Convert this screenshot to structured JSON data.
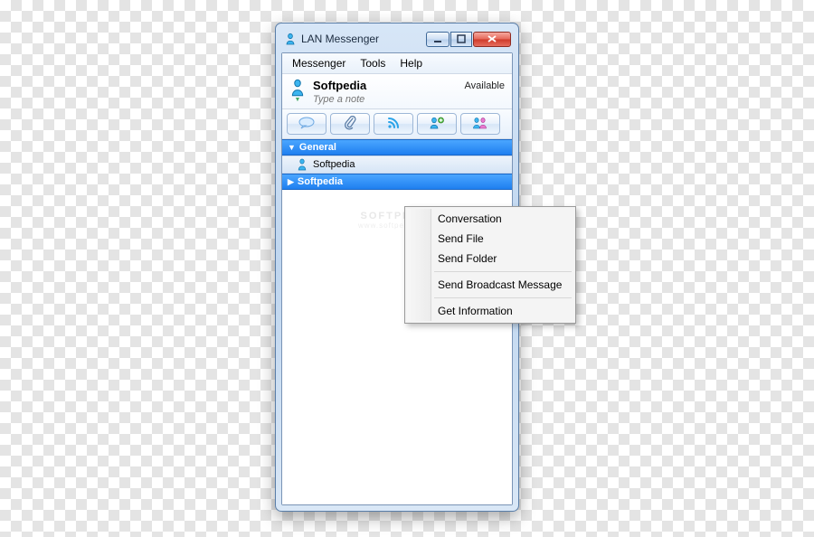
{
  "window": {
    "title": "LAN Messenger"
  },
  "menubar": {
    "items": [
      "Messenger",
      "Tools",
      "Help"
    ]
  },
  "user": {
    "name": "Softpedia",
    "status": "Available",
    "note_placeholder": "Type a note"
  },
  "groups": [
    {
      "name": "General",
      "expanded": true
    },
    {
      "name": "Softpedia",
      "expanded": false
    }
  ],
  "contacts": [
    {
      "name": "Softpedia"
    }
  ],
  "context_menu": {
    "items": [
      "Conversation",
      "Send File",
      "Send Folder",
      "Send Broadcast Message",
      "Get Information"
    ]
  },
  "watermark": {
    "line1": "SOFTPEDIA",
    "line2": "www.softpedia.com"
  }
}
